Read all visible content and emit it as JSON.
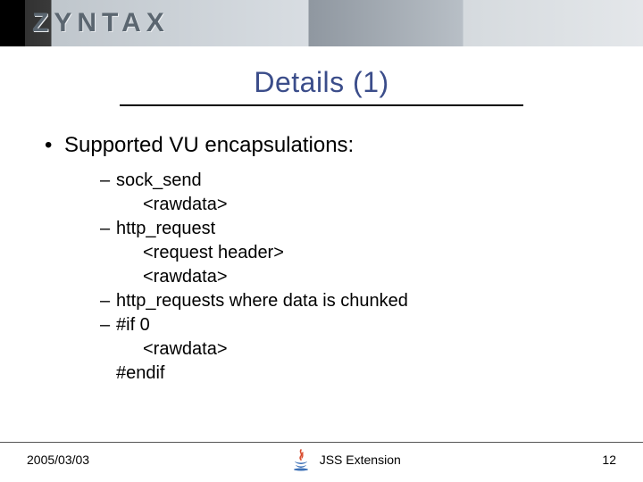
{
  "banner": {
    "logo": "ZYNTAX"
  },
  "title": "Details (1)",
  "bullet": "Supported VU encapsulations:",
  "items": [
    {
      "head": "sock_send",
      "lines": [
        "<rawdata>"
      ]
    },
    {
      "head": "http_request",
      "lines": [
        "<request header>",
        "<rawdata>"
      ]
    },
    {
      "head": "http_requests where data is chunked",
      "lines": []
    },
    {
      "head": "#if 0",
      "lines": [
        "<rawdata>"
      ],
      "tail": "#endif"
    }
  ],
  "footer": {
    "date": "2005/03/03",
    "center_label": "JSS Extension",
    "page": "12",
    "icon": "java-icon"
  }
}
